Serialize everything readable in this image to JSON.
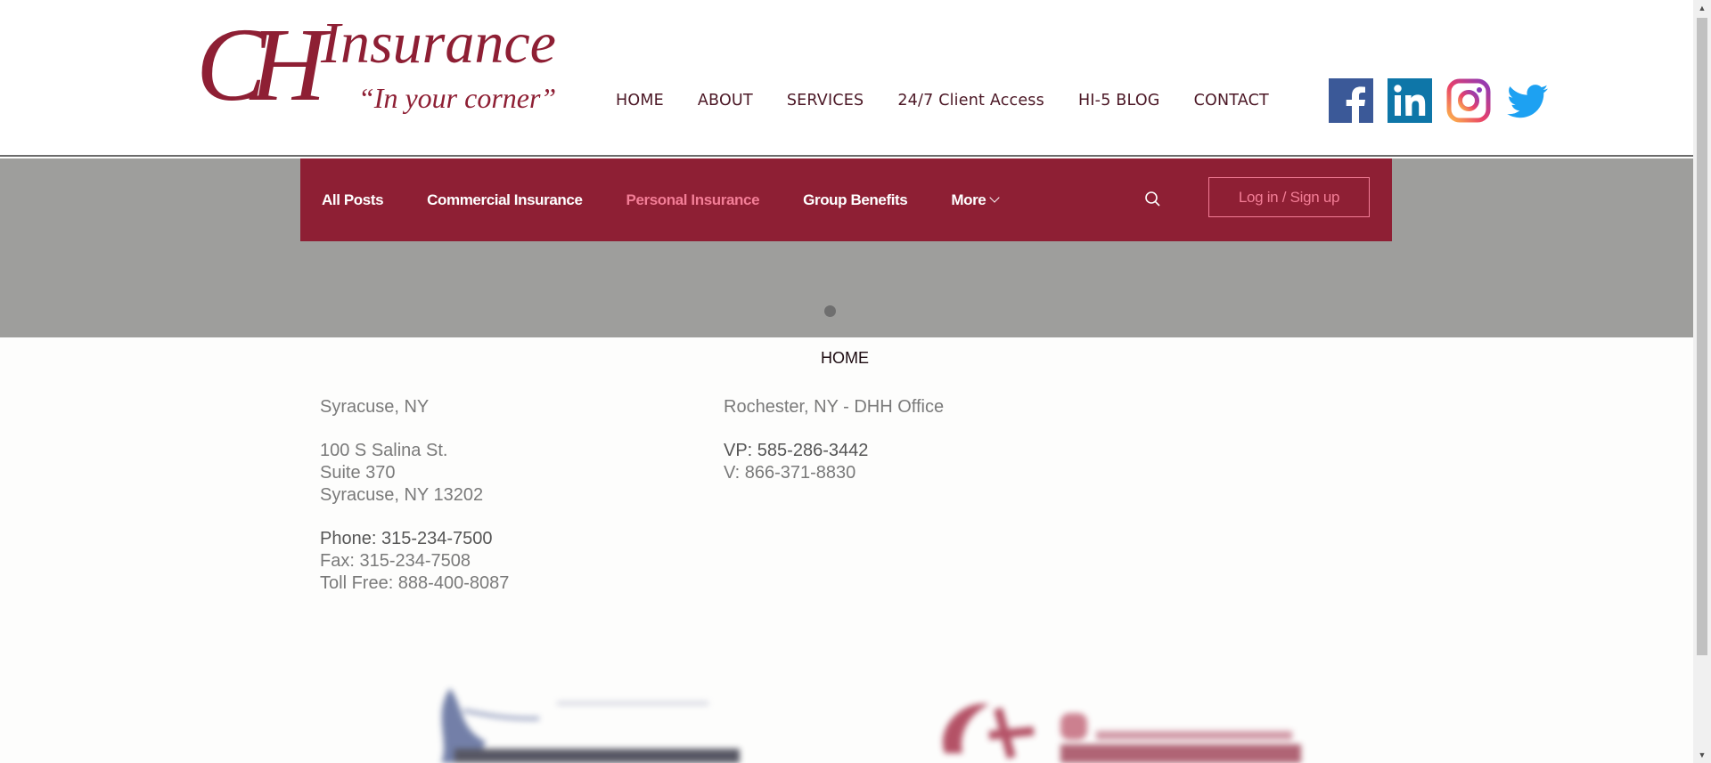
{
  "header": {
    "logo": {
      "monogram": "CH",
      "word": "Insurance",
      "tagline": "“In your corner”"
    },
    "nav": [
      {
        "label": "HOME"
      },
      {
        "label": "ABOUT"
      },
      {
        "label": "SERVICES"
      },
      {
        "label": "24/7 Client Access"
      },
      {
        "label": "HI-5 BLOG"
      },
      {
        "label": "CONTACT"
      }
    ],
    "social": [
      "facebook-icon",
      "linkedin-icon",
      "instagram-icon",
      "twitter-icon"
    ]
  },
  "blog": {
    "menu": [
      {
        "label": "All Posts"
      },
      {
        "label": "Commercial Insurance"
      },
      {
        "label": "Personal Insurance"
      },
      {
        "label": "Group Benefits"
      },
      {
        "label": "More"
      }
    ],
    "login_label": "Log in / Sign up"
  },
  "content": {
    "home_link": "HOME",
    "syracuse": {
      "title": "Syracuse, NY",
      "address1": "100 S Salina St.",
      "address2": "Suite 370",
      "address3": "Syracuse, NY 13202",
      "phone": "Phone: 315-234-7500",
      "fax": "Fax: 315-234-7508",
      "tollfree": "Toll Free: 888-400-8087"
    },
    "rochester": {
      "title": "Rochester, NY - DHH Office",
      "vp": "VP: 585-286-3442",
      "v": "V: 866-371-8830"
    }
  },
  "colors": {
    "brand": "#8e1f34",
    "accent_pink": "#f37d96",
    "nav_text": "#4b1725",
    "band_gray": "#9e9e9c"
  }
}
